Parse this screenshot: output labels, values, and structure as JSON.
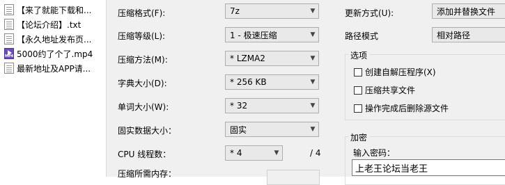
{
  "files": [
    {
      "name": "【来了就能下载和...",
      "type": "txt"
    },
    {
      "name": "【论坛介绍】.txt",
      "type": "txt"
    },
    {
      "name": "【永久地址发布页...",
      "type": "txt"
    },
    {
      "name": "5000约了个了.mp4",
      "type": "mp4"
    },
    {
      "name": "最新地址及APP请...",
      "type": "txt"
    }
  ],
  "settings": {
    "format": {
      "label": "压缩格式(F):",
      "value": "7z"
    },
    "level": {
      "label": "压缩等级(L):",
      "value": "1 - 极速压缩"
    },
    "method": {
      "label": "压缩方法(M):",
      "value": "* LZMA2"
    },
    "dict": {
      "label": "字典大小(D):",
      "value": "* 256 KB"
    },
    "word": {
      "label": "单词大小(W):",
      "value": "* 32"
    },
    "solid": {
      "label": "固实数据大小：",
      "value": "固实"
    },
    "threads": {
      "label": "CPU 线程数：",
      "value": "* 4",
      "max": "/ 4"
    },
    "memory": {
      "label": "压缩所需内存："
    }
  },
  "right": {
    "update": {
      "label": "更新方式(U):",
      "value": "添加并替换文件"
    },
    "pathmode": {
      "label": "路径模式",
      "value": "相对路径"
    },
    "options": {
      "title": "选项",
      "items": [
        "创建自解压程序(X)",
        "压缩共享文件",
        "操作完成后删除源文件"
      ]
    },
    "encryption": {
      "title": "加密",
      "input_label": "输入密码：",
      "password": "上老王论坛当老王"
    }
  }
}
